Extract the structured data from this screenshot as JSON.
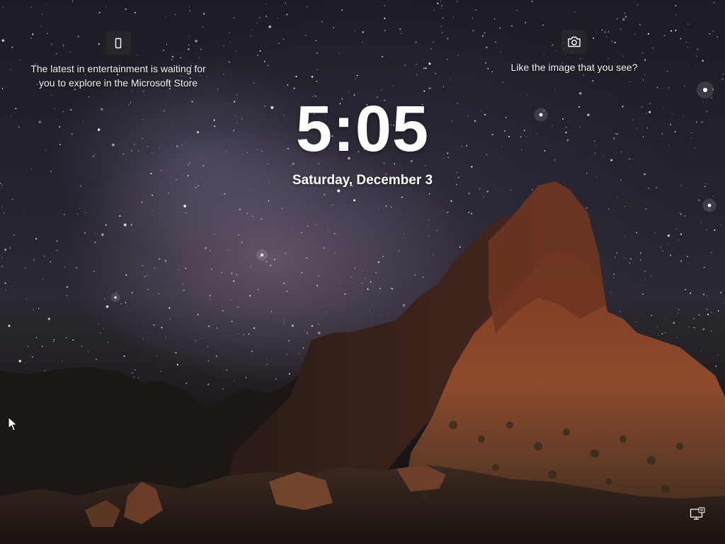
{
  "screen": {
    "type": "lock-screen",
    "background": "Night sky with the Milky Way above a rocky mountain"
  },
  "clock": {
    "time": "5:05",
    "date": "Saturday, December 3"
  },
  "spotlight": {
    "left": {
      "icon": "phone-icon",
      "text": "The latest in entertainment is waiting for you to explore in the Microsoft Store"
    },
    "right": {
      "icon": "camera-icon",
      "text": "Like the image that you see?"
    }
  },
  "status": {
    "network_icon": "network-icon"
  },
  "colors": {
    "text": "#ffffff",
    "icon_button_bg": "#28282c",
    "rock_lit": "#8a4a2c",
    "rock_dark": "#2a1c18"
  }
}
